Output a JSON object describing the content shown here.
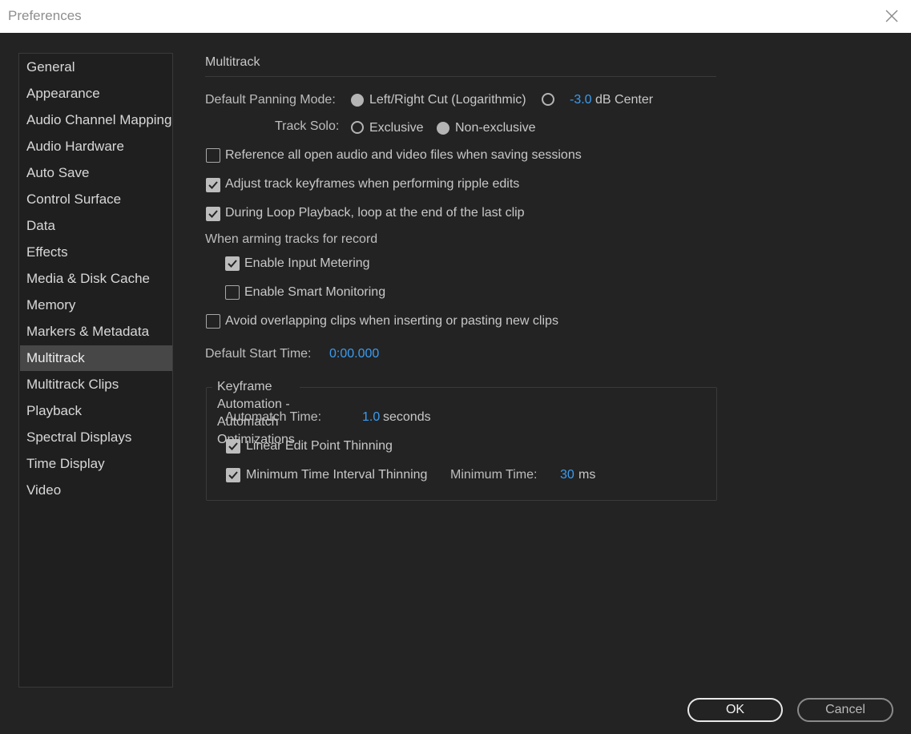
{
  "window": {
    "title": "Preferences",
    "close_icon": "close-icon"
  },
  "sidebar": {
    "selected": "Multitrack",
    "items": [
      {
        "label": "General"
      },
      {
        "label": "Appearance"
      },
      {
        "label": "Audio Channel Mapping"
      },
      {
        "label": "Audio Hardware"
      },
      {
        "label": "Auto Save"
      },
      {
        "label": "Control Surface"
      },
      {
        "label": "Data"
      },
      {
        "label": "Effects"
      },
      {
        "label": "Media & Disk Cache"
      },
      {
        "label": "Memory"
      },
      {
        "label": "Markers & Metadata"
      },
      {
        "label": "Multitrack"
      },
      {
        "label": "Multitrack Clips"
      },
      {
        "label": "Playback"
      },
      {
        "label": "Spectral Displays"
      },
      {
        "label": "Time Display"
      },
      {
        "label": "Video"
      }
    ]
  },
  "multitrack": {
    "section_title": "Multitrack",
    "panning": {
      "label": "Default Panning Mode:",
      "option1": "Left/Right Cut (Logarithmic)",
      "option1_selected": true,
      "option2_value": "-3.0",
      "option2_suffix": "dB Center",
      "option2_selected": false
    },
    "track_solo": {
      "label": "Track Solo:",
      "option1": "Exclusive",
      "option1_selected": false,
      "option2": "Non-exclusive",
      "option2_selected": true
    },
    "checkboxes": {
      "reference_all": {
        "label": "Reference all open audio and video files when saving sessions",
        "checked": false
      },
      "adjust_keyframes": {
        "label": "Adjust track keyframes when performing ripple edits",
        "checked": true
      },
      "loop_playback": {
        "label": "During Loop Playback, loop at the end of the last clip",
        "checked": true
      }
    },
    "arming": {
      "label": "When arming tracks for record",
      "input_metering": {
        "label": "Enable Input Metering",
        "checked": true
      },
      "smart_monitoring": {
        "label": "Enable Smart Monitoring",
        "checked": false
      }
    },
    "avoid_overlapping": {
      "label": "Avoid overlapping clips when inserting or pasting new clips",
      "checked": false
    },
    "start_time": {
      "label": "Default Start Time:",
      "value": "0:00.000"
    },
    "keyframe_group": {
      "title": "Keyframe Automation - Automatch Optimizations",
      "automatch_label": "Automatch Time:",
      "automatch_value": "1.0",
      "automatch_unit": "seconds",
      "linear_thinning": {
        "label": "Linear Edit Point Thinning",
        "checked": true
      },
      "min_interval": {
        "label": "Minimum Time Interval Thinning",
        "checked": true
      },
      "min_time_label": "Minimum Time:",
      "min_time_value": "30",
      "min_time_unit": "ms"
    }
  },
  "buttons": {
    "ok": "OK",
    "cancel": "Cancel"
  },
  "colors": {
    "accent": "#3b9cf0",
    "background": "#232323",
    "selected_item": "#474747"
  }
}
